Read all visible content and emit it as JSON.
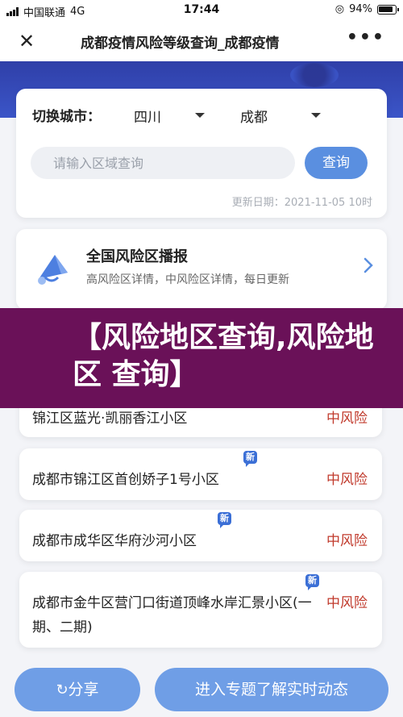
{
  "status_bar": {
    "carrier": "中国联通",
    "network": "4G",
    "time": "17:44",
    "battery": "94%"
  },
  "navbar": {
    "close_icon": "close-icon",
    "title": "成都疫情风险等级查询_成都疫情",
    "more_icon": "more-icon"
  },
  "selector": {
    "label": "切换城市：",
    "province": "四川",
    "city": "成都",
    "search_placeholder": "请输入区域查询",
    "query_button": "查询",
    "update_date": "更新日期：2021-11-05 10时"
  },
  "broadcast": {
    "icon": "megaphone-icon",
    "title": "全国风险区播报",
    "subtitle": "高风险区详情，中风险区详情，每日更新"
  },
  "overlay_text": "【风险地区查询,风险地区 查询】",
  "risk_list": [
    {
      "name": "锦江区蓝光·凯丽香江小区",
      "level": "中风险",
      "is_new": false,
      "new_label": ""
    },
    {
      "name": "成都市锦江区首创娇子1号小区",
      "level": "中风险",
      "is_new": true,
      "new_label": "新"
    },
    {
      "name": "成都市成华区华府沙河小区",
      "level": "中风险",
      "is_new": true,
      "new_label": "新"
    },
    {
      "name": "成都市金牛区营门口街道顶峰水岸汇景小区(一期、二期)",
      "level": "中风险",
      "is_new": true,
      "new_label": "新"
    }
  ],
  "footer": {
    "share_label": "分享",
    "topic_label": "进入专题了解实时动态"
  },
  "colors": {
    "accent": "#5a8fe0",
    "risk_medium": "#c0392b",
    "overlay": "#6a1158",
    "banner": "#3b55c8"
  }
}
